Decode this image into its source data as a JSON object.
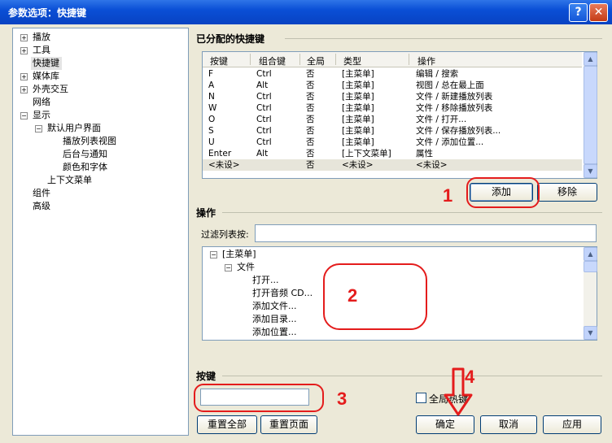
{
  "window": {
    "title": "参数选项：快捷键",
    "help": "?",
    "close": "✕"
  },
  "tree": {
    "items": [
      {
        "label": "播放",
        "expander": "+"
      },
      {
        "label": "工具",
        "expander": "+"
      },
      {
        "label": "快捷键",
        "expander": ""
      },
      {
        "label": "媒体库",
        "expander": "+"
      },
      {
        "label": "外壳交互",
        "expander": "+"
      },
      {
        "label": "网络",
        "expander": ""
      },
      {
        "label": "显示",
        "expander": "−"
      },
      {
        "label": "默认用户界面",
        "expander": "−"
      },
      {
        "label": "播放列表视图",
        "expander": ""
      },
      {
        "label": "后台与通知",
        "expander": ""
      },
      {
        "label": "颜色和字体",
        "expander": ""
      },
      {
        "label": "上下文菜单",
        "expander": ""
      },
      {
        "label": "组件",
        "expander": ""
      },
      {
        "label": "高级",
        "expander": ""
      }
    ]
  },
  "assigned": {
    "title": "已分配的快捷键",
    "columns": [
      "按键",
      "组合键",
      "全局",
      "类型",
      "操作"
    ],
    "rows": [
      [
        "F",
        "Ctrl",
        "否",
        "[主菜单]",
        "编辑 / 搜索"
      ],
      [
        "A",
        "Alt",
        "否",
        "[主菜单]",
        "视图 / 总在最上面"
      ],
      [
        "N",
        "Ctrl",
        "否",
        "[主菜单]",
        "文件 / 新建播放列表"
      ],
      [
        "W",
        "Ctrl",
        "否",
        "[主菜单]",
        "文件 / 移除播放列表"
      ],
      [
        "O",
        "Ctrl",
        "否",
        "[主菜单]",
        "文件 / 打开..."
      ],
      [
        "S",
        "Ctrl",
        "否",
        "[主菜单]",
        "文件 / 保存播放列表..."
      ],
      [
        "U",
        "Ctrl",
        "否",
        "[主菜单]",
        "文件 / 添加位置..."
      ],
      [
        "Enter",
        "Alt",
        "否",
        "[上下文菜单]",
        "属性"
      ],
      [
        "<未设>",
        "",
        "否",
        "<未设>",
        "<未设>"
      ]
    ],
    "add_button": "添加",
    "remove_button": "移除"
  },
  "actions": {
    "title": "操作",
    "filter_label": "过滤列表按:",
    "filter_value": "",
    "tree": [
      {
        "label": "[主菜单]",
        "expander": "−"
      },
      {
        "label": "文件",
        "expander": "−"
      },
      {
        "label": "打开...",
        "expander": ""
      },
      {
        "label": "打开音频 CD...",
        "expander": ""
      },
      {
        "label": "添加文件...",
        "expander": ""
      },
      {
        "label": "添加目录...",
        "expander": ""
      },
      {
        "label": "添加位置...",
        "expander": ""
      }
    ]
  },
  "key": {
    "title": "按键",
    "input_value": "",
    "global_checkbox_label": "全局热键",
    "reset_all": "重置全部",
    "reset_page": "重置页面"
  },
  "dialog_buttons": {
    "ok": "确定",
    "cancel": "取消",
    "apply": "应用"
  },
  "annotations": {
    "n1": "1",
    "n2": "2",
    "n3": "3",
    "n4": "4",
    "color": "#e41c1c"
  }
}
